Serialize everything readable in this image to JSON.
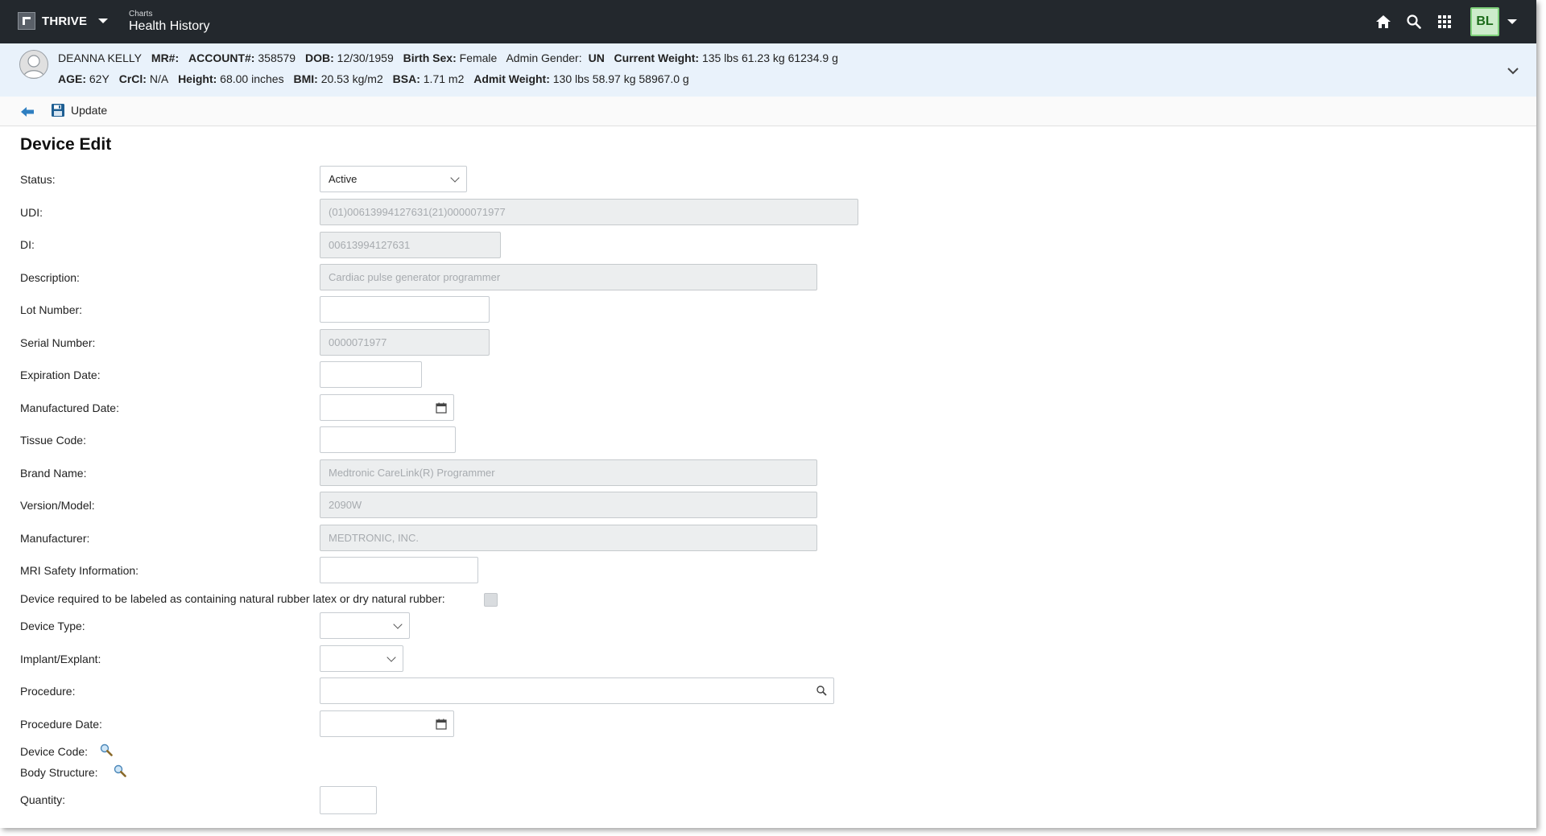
{
  "app": {
    "brand": "THRIVE",
    "crumb_small": "Charts",
    "crumb_title": "Health History",
    "user_initials": "BL"
  },
  "icons": [
    "home-icon",
    "search-icon",
    "apps-grid-icon",
    "user-avatar",
    "back-arrow-icon",
    "save-icon",
    "calendar-icon",
    "magnifier-icon",
    "chevron-down-icon"
  ],
  "patient": {
    "name": "DEANNA KELLY",
    "mr_label": "MR#:",
    "mr": "",
    "account_label": "ACCOUNT#:",
    "account": "358579",
    "dob_label": "DOB:",
    "dob": "12/30/1959",
    "birth_sex_label": "Birth Sex:",
    "birth_sex": "Female",
    "admin_gender_label": "Admin Gender:",
    "admin_gender": "UN",
    "current_weight_label": "Current Weight:",
    "current_weight": "135 lbs 61.23 kg 61234.9 g",
    "age_label": "AGE:",
    "age": "62Y",
    "crcl_label": "CrCl:",
    "crcl": "N/A",
    "height_label": "Height:",
    "height": "68.00 inches",
    "bmi_label": "BMI:",
    "bmi": "20.53 kg/m2",
    "bsa_label": "BSA:",
    "bsa": "1.71 m2",
    "admit_weight_label": "Admit Weight:",
    "admit_weight": "130 lbs 58.97 kg 58967.0 g"
  },
  "toolbar": {
    "update_label": "Update"
  },
  "form": {
    "title": "Device Edit",
    "status": {
      "label": "Status:",
      "value": "Active"
    },
    "udi": {
      "label": "UDI:",
      "value": "(01)00613994127631(21)0000071977"
    },
    "di": {
      "label": "DI:",
      "value": "00613994127631"
    },
    "description": {
      "label": "Description:",
      "value": "Cardiac pulse generator programmer"
    },
    "lot_number": {
      "label": "Lot Number:",
      "value": ""
    },
    "serial_number": {
      "label": "Serial Number:",
      "value": "0000071977"
    },
    "expiration_date": {
      "label": "Expiration Date:",
      "value": ""
    },
    "manufactured_date": {
      "label": "Manufactured Date:",
      "value": ""
    },
    "tissue_code": {
      "label": "Tissue Code:",
      "value": ""
    },
    "brand_name": {
      "label": "Brand Name:",
      "value": "Medtronic CareLink(R) Programmer"
    },
    "version_model": {
      "label": "Version/Model:",
      "value": "2090W"
    },
    "manufacturer": {
      "label": "Manufacturer:",
      "value": "MEDTRONIC, INC."
    },
    "mri_safety": {
      "label": "MRI Safety Information:",
      "value": ""
    },
    "latex": {
      "label": "Device required to be labeled as containing natural rubber latex or dry natural rubber:",
      "checked": false
    },
    "device_type": {
      "label": "Device Type:",
      "value": ""
    },
    "implant_explant": {
      "label": "Implant/Explant:",
      "value": ""
    },
    "procedure": {
      "label": "Procedure:",
      "value": ""
    },
    "procedure_date": {
      "label": "Procedure Date:",
      "value": ""
    },
    "device_code": {
      "label": "Device Code:"
    },
    "body_structure": {
      "label": "Body Structure:"
    },
    "quantity": {
      "label": "Quantity:",
      "value": ""
    }
  }
}
